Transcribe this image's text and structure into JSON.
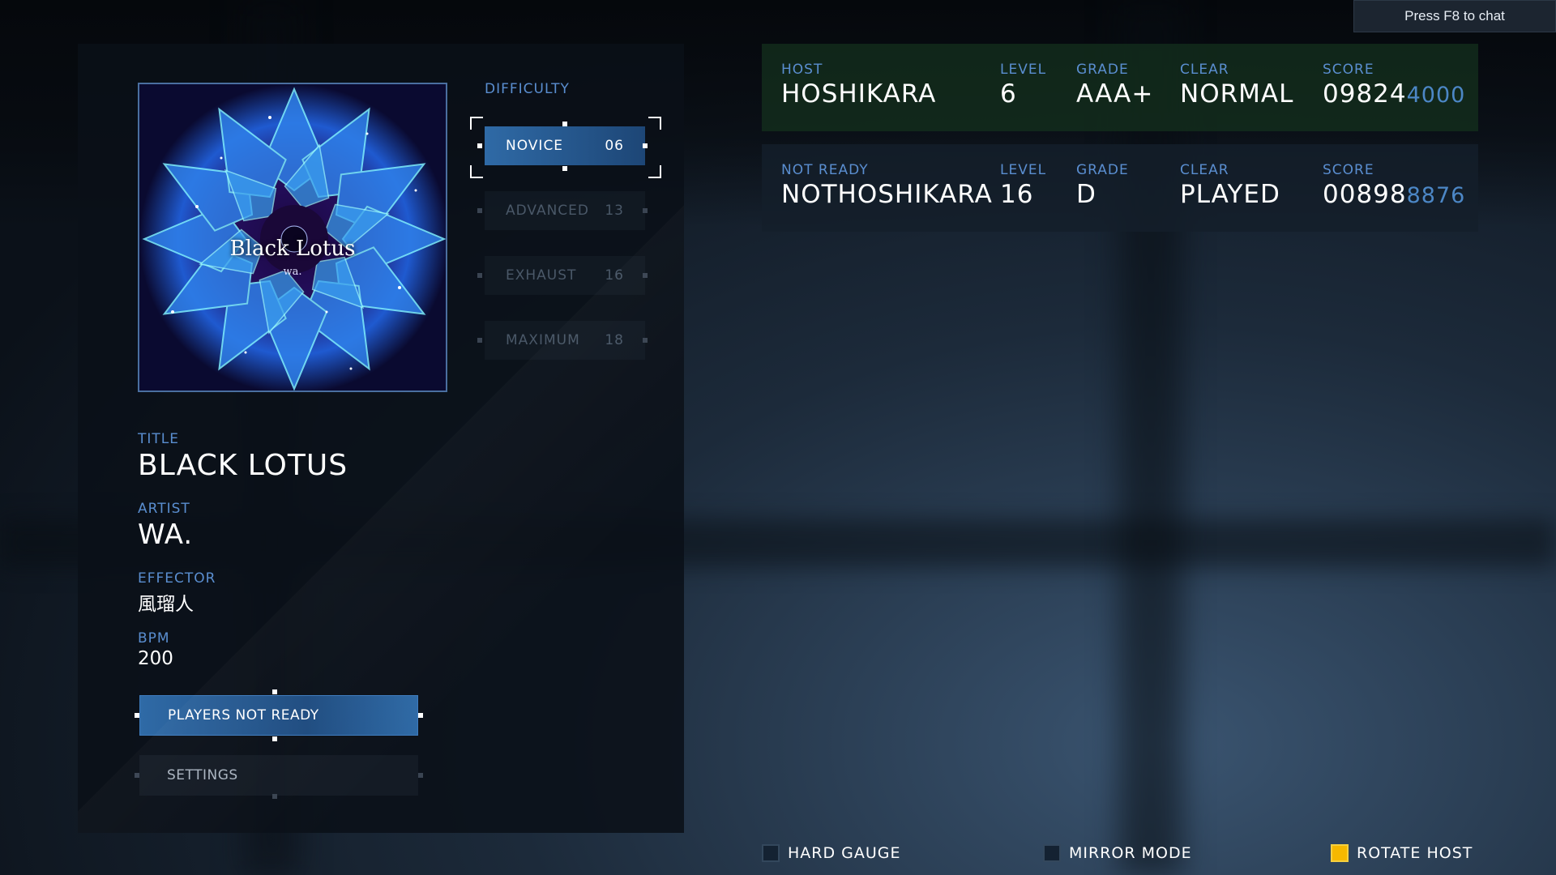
{
  "chat_hint": "Press F8 to chat",
  "song": {
    "jacket_title": "Black Lotus",
    "jacket_artist": "wa.",
    "title_label": "TITLE",
    "title": "BLACK LOTUS",
    "artist_label": "ARTIST",
    "artist": "WA.",
    "effector_label": "EFFECTOR",
    "effector": "風瑠人",
    "bpm_label": "BPM",
    "bpm": "200"
  },
  "difficulty": {
    "label": "DIFFICULTY",
    "items": [
      {
        "name": "NOVICE",
        "level": "06",
        "selected": true
      },
      {
        "name": "ADVANCED",
        "level": "13",
        "selected": false
      },
      {
        "name": "EXHAUST",
        "level": "16",
        "selected": false
      },
      {
        "name": "MAXIMUM",
        "level": "18",
        "selected": false
      }
    ]
  },
  "buttons": {
    "ready": "PLAYERS NOT READY",
    "settings": "SETTINGS"
  },
  "players": [
    {
      "status_label": "HOST",
      "name": "HOSHIKARA",
      "level_label": "LEVEL",
      "level": "6",
      "grade_label": "GRADE",
      "grade": "AAA+",
      "clear_label": "CLEAR",
      "clear": "NORMAL",
      "score_label": "SCORE",
      "score_main": "09824",
      "score_sub": "4000"
    },
    {
      "status_label": "NOT READY",
      "name": "NOTHOSHIKARA",
      "level_label": "LEVEL",
      "level": "16",
      "grade_label": "GRADE",
      "grade": "D",
      "clear_label": "CLEAR",
      "clear": "PLAYED",
      "score_label": "SCORE",
      "score_main": "00898",
      "score_sub": "8876"
    }
  ],
  "options": [
    {
      "label": "HARD GAUGE",
      "checked": false
    },
    {
      "label": "MIRROR MODE",
      "checked": false
    },
    {
      "label": "ROTATE HOST",
      "checked": true
    }
  ],
  "colors": {
    "accent_blue": "#5a8ed0",
    "selected_blue": "#2f6aa6",
    "host_card": "#14301e",
    "checkbox_on": "#f5b800"
  }
}
